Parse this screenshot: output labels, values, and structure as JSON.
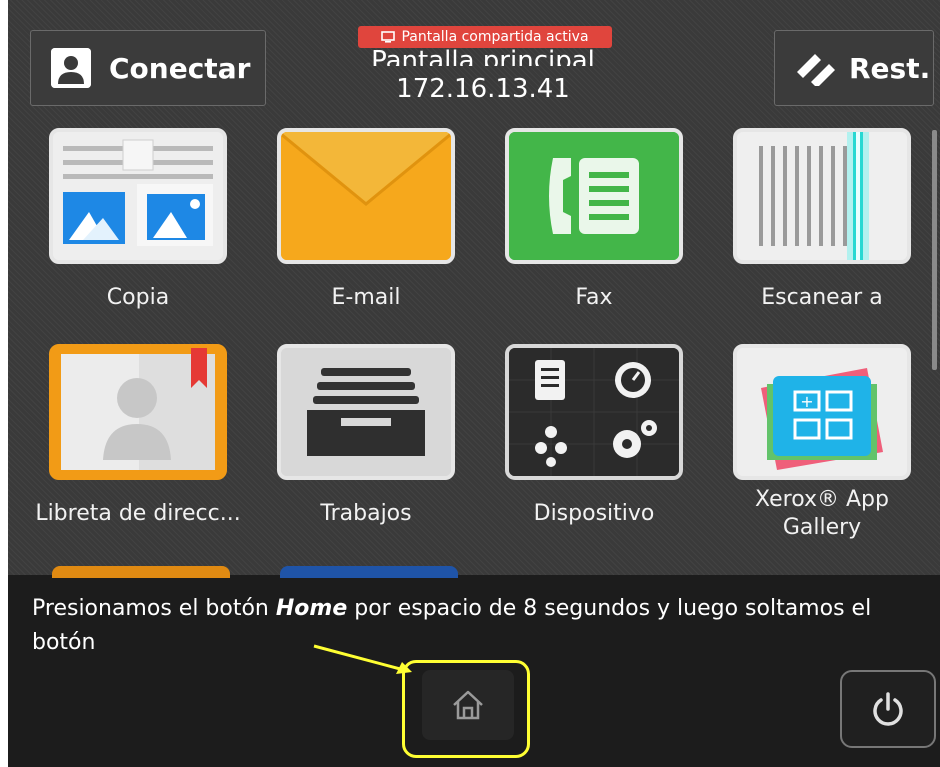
{
  "header": {
    "connect_label": "Conectar",
    "reset_label": "Rest.",
    "title": "Pantalla principal",
    "address": "172.16.13.41",
    "share_badge": "Pantalla compartida activa"
  },
  "apps": [
    {
      "label": "Copia",
      "icon": "copy-icon"
    },
    {
      "label": "E-mail",
      "icon": "envelope-icon"
    },
    {
      "label": "Fax",
      "icon": "fax-icon"
    },
    {
      "label": "Escanear a",
      "icon": "scanner-icon"
    },
    {
      "label": "Libreta de direcc...",
      "icon": "address-book-icon"
    },
    {
      "label": "Trabajos",
      "icon": "jobs-tray-icon"
    },
    {
      "label": "Dispositivo",
      "icon": "device-icon"
    },
    {
      "label": "Xerox® App Gallery",
      "icon": "app-gallery-icon"
    }
  ],
  "caption": {
    "before": "Presionamos  el botón ",
    "bold": "Home",
    "after": " por espacio de 8 segundos y luego soltamos el botón"
  },
  "colors": {
    "highlight": "#ffff33",
    "share_badge": "#e0453d",
    "email_tile": "#f5a316",
    "fax_tile": "#3cb44a"
  }
}
